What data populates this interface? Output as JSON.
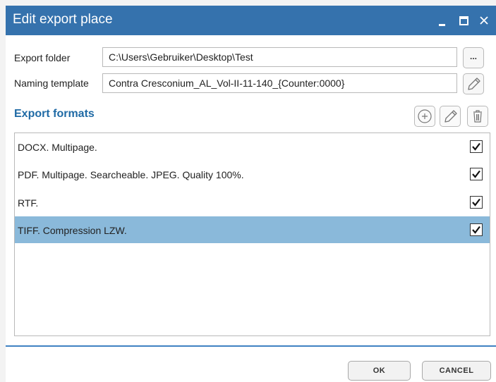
{
  "window": {
    "title": "Edit export place",
    "controls": [
      "minimize-icon",
      "maximize-icon",
      "close-icon"
    ]
  },
  "export_folder": {
    "label": "Export folder",
    "value": "C:\\Users\\Gebruiker\\Desktop\\Test",
    "browse_label": "..."
  },
  "naming_template": {
    "label": "Naming template",
    "value": "Contra Cresconium_AL_Vol-II-11-140_{Counter:0000}",
    "edit_icon": "pencil-icon"
  },
  "formats": {
    "title": "Export formats",
    "toolbar_icons": [
      "add-icon",
      "edit-icon",
      "delete-icon"
    ],
    "items": [
      {
        "label": "DOCX. Multipage.",
        "checked": true,
        "selected": false
      },
      {
        "label": "PDF. Multipage. Searcheable. JPEG. Quality 100%.",
        "checked": true,
        "selected": false
      },
      {
        "label": "RTF.",
        "checked": true,
        "selected": false
      },
      {
        "label": "TIFF. Compression LZW.",
        "checked": true,
        "selected": true
      }
    ]
  },
  "footer": {
    "ok_label": "OK",
    "cancel_label": "CANCEL"
  },
  "colors": {
    "titlebar": "#3572ad",
    "accent": "#1f6aa5",
    "selection": "#8ab9da"
  }
}
